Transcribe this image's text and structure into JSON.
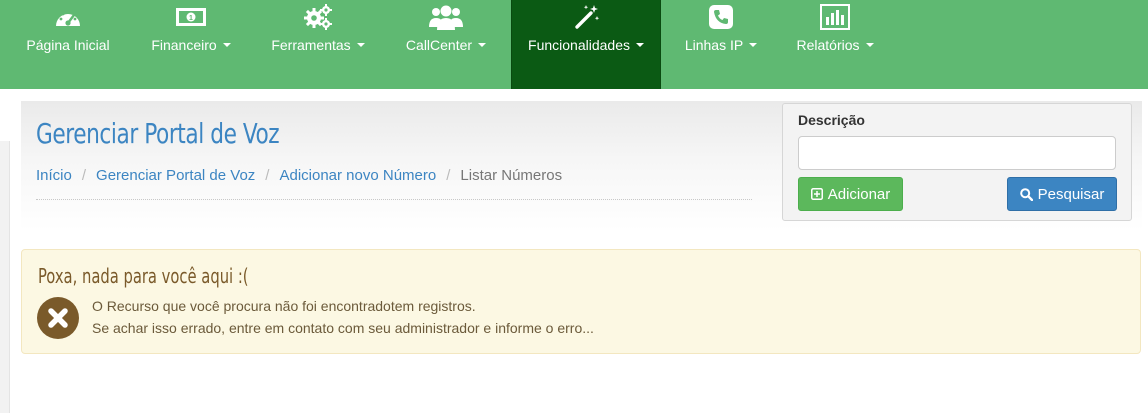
{
  "nav": {
    "items": [
      {
        "label": "Página Inicial",
        "icon": "dashboard-gauge-icon",
        "dropdown": false,
        "active": false
      },
      {
        "label": "Financeiro",
        "icon": "banknote-icon",
        "dropdown": true,
        "active": false
      },
      {
        "label": "Ferramentas",
        "icon": "gears-icon",
        "dropdown": true,
        "active": false
      },
      {
        "label": "CallCenter",
        "icon": "users-group-icon",
        "dropdown": true,
        "active": false
      },
      {
        "label": "Funcionalidades",
        "icon": "magic-wand-icon",
        "dropdown": true,
        "active": true
      },
      {
        "label": "Linhas IP",
        "icon": "phone-square-icon",
        "dropdown": true,
        "active": false
      },
      {
        "label": "Relatórios",
        "icon": "bar-chart-icon",
        "dropdown": true,
        "active": false
      }
    ]
  },
  "page": {
    "title": "Gerenciar Portal de Voz",
    "breadcrumb": {
      "items": [
        {
          "label": "Início",
          "link": true
        },
        {
          "label": "Gerenciar Portal de Voz",
          "link": true
        },
        {
          "label": "Adicionar novo Número",
          "link": true
        },
        {
          "label": "Listar Números",
          "link": false
        }
      ],
      "separator": "/"
    }
  },
  "search": {
    "label": "Descrição",
    "input_value": "",
    "input_placeholder": "",
    "add_label": "Adicionar",
    "search_label": "Pesquisar"
  },
  "alert": {
    "title": "Poxa, nada para você aqui :(",
    "line1": "O Recurso que você procura não foi encontradotem registros.",
    "line2": "Se achar isso errado, entre em contato com seu administrador e informe o erro..."
  },
  "colors": {
    "navbar": "#5fb972",
    "nav_active": "#0b5a14",
    "link": "#3c85c2",
    "add_button": "#5cb85c",
    "search_button": "#3c85c2",
    "alert_bg": "#fcf8e3",
    "alert_icon": "#7a5a2a"
  }
}
